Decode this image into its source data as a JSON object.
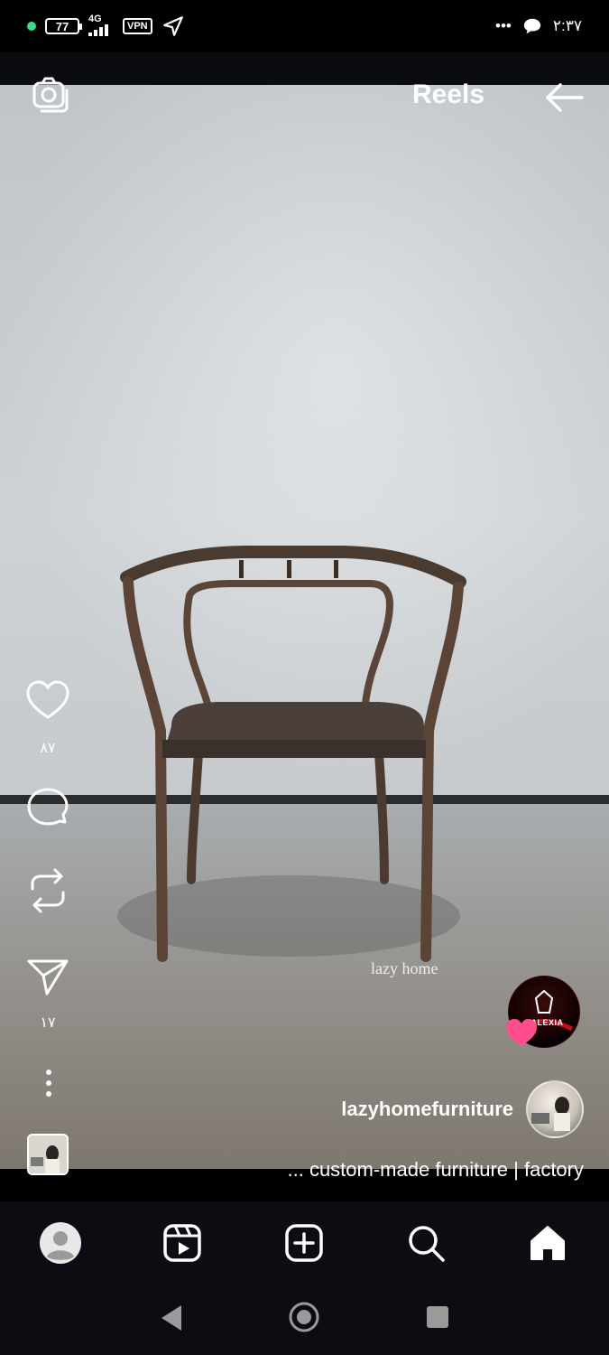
{
  "status_bar": {
    "battery": "77",
    "network": "4G",
    "vpn": "VPN",
    "time": "۲:۳۷",
    "overflow": "•••"
  },
  "header": {
    "title": "Reels",
    "camera_icon": "camera-icon",
    "back_icon": "arrow-back-icon"
  },
  "actions": {
    "likes": "۸۷",
    "shares": "۱۷"
  },
  "video": {
    "watermark": "lazy home"
  },
  "music": {
    "brand_text": "KALEXIA"
  },
  "post": {
    "username": "lazyhomefurniture",
    "caption": "... custom-made furniture |  factory"
  },
  "bottom_nav": {
    "items": [
      "profile",
      "reels",
      "create",
      "search",
      "home"
    ]
  },
  "colors": {
    "background": "#000000",
    "nav_background": "#0b0d12",
    "status_dot": "#3ddc84",
    "heart_sticker": "#ff4d8d"
  }
}
